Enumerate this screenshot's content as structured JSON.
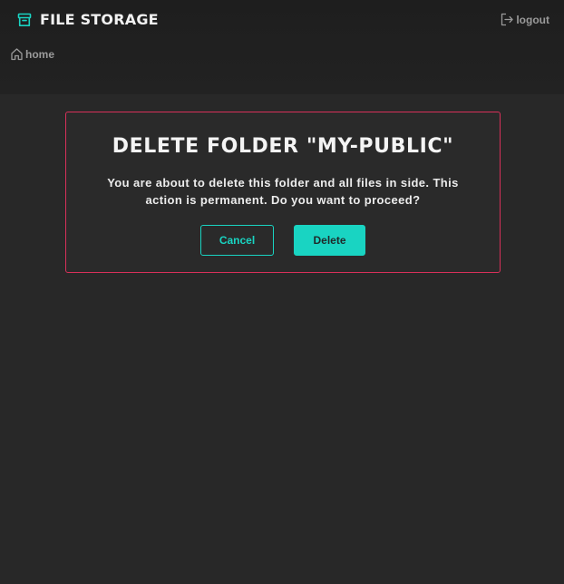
{
  "app": {
    "title": "FILE STORAGE",
    "logout_label": "logout"
  },
  "breadcrumb": {
    "home_label": "home"
  },
  "dialog": {
    "title": "DELETE FOLDER \"MY-PUBLIC\"",
    "message_line1": "You are about to delete this folder and all files in side. This",
    "message_line2": "action is permanent. Do you want to proceed?",
    "cancel_label": "Cancel",
    "delete_label": "Delete"
  },
  "icons": {
    "brand": "archive-box-icon",
    "logout": "logout-arrow-icon",
    "home": "home-icon"
  },
  "colors": {
    "accent": "#19d4c2",
    "danger_border": "#d8305a",
    "background": "#282828",
    "header_background": "#1f1f1f"
  }
}
